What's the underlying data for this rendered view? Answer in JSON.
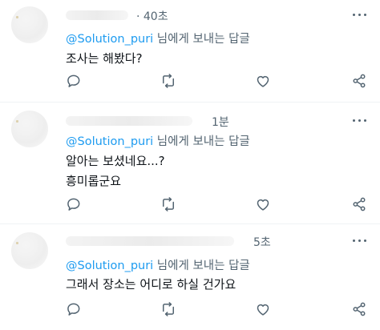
{
  "tweets": [
    {
      "time": "· 40초",
      "reply_handle": "@Solution_puri",
      "reply_suffix": " 님에게 보내는 답글",
      "lines": [
        "조사는 해봤다?"
      ]
    },
    {
      "time": "1분",
      "reply_handle": "@Solution_puri",
      "reply_suffix": " 님에게 보내는 답글",
      "lines": [
        "알아는 보셨네요...?",
        "흥미롭군요"
      ]
    },
    {
      "time": "5초",
      "reply_handle": "@Solution_puri",
      "reply_suffix": " 님에게 보내는 답글",
      "lines": [
        "그래서 장소는 어디로 하실 건가요"
      ]
    }
  ],
  "icons": {
    "more": "more-icon",
    "reply": "reply-icon",
    "retweet": "retweet-icon",
    "like": "like-icon",
    "share": "share-icon"
  },
  "colors": {
    "handle": "#1d9bf0",
    "secondary": "#536471",
    "text": "#0f1419",
    "divider": "#eff3f4"
  }
}
